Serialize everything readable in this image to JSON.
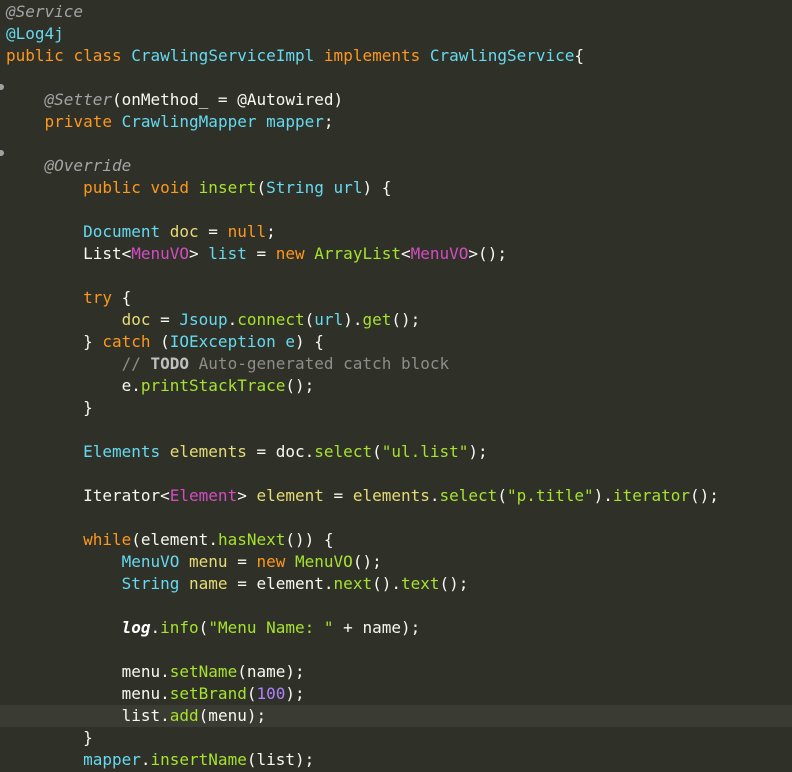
{
  "editor": {
    "lines": [
      {
        "segments": [
          {
            "t": "@Service",
            "c": "tok-annot"
          }
        ]
      },
      {
        "segments": [
          {
            "t": "@Log4j",
            "c": "tok-annot2"
          }
        ]
      },
      {
        "segments": [
          {
            "t": "public",
            "c": "tok-kw2"
          },
          {
            "t": " ",
            "c": "tok-plain"
          },
          {
            "t": "class",
            "c": "tok-kw2"
          },
          {
            "t": " ",
            "c": "tok-plain"
          },
          {
            "t": "CrawlingServiceImpl",
            "c": "tok-type"
          },
          {
            "t": " ",
            "c": "tok-plain"
          },
          {
            "t": "implements",
            "c": "tok-kw2"
          },
          {
            "t": " ",
            "c": "tok-plain"
          },
          {
            "t": "CrawlingService",
            "c": "tok-type"
          },
          {
            "t": "{",
            "c": "tok-plain"
          }
        ]
      },
      {
        "segments": []
      },
      {
        "segments": [
          {
            "t": "    ",
            "c": "tok-plain"
          },
          {
            "t": "@Setter",
            "c": "tok-annot"
          },
          {
            "t": "(onMethod_ = @Autowired)",
            "c": "tok-plain"
          }
        ]
      },
      {
        "segments": [
          {
            "t": "    ",
            "c": "tok-plain"
          },
          {
            "t": "private",
            "c": "tok-kw2"
          },
          {
            "t": " ",
            "c": "tok-plain"
          },
          {
            "t": "CrawlingMapper",
            "c": "tok-type"
          },
          {
            "t": " ",
            "c": "tok-plain"
          },
          {
            "t": "mapper",
            "c": "tok-type"
          },
          {
            "t": ";",
            "c": "tok-plain"
          }
        ]
      },
      {
        "segments": []
      },
      {
        "segments": [
          {
            "t": "    ",
            "c": "tok-plain"
          },
          {
            "t": "@Override",
            "c": "tok-annot"
          }
        ]
      },
      {
        "segments": [
          {
            "t": "        ",
            "c": "tok-plain"
          },
          {
            "t": "public",
            "c": "tok-kw2"
          },
          {
            "t": " ",
            "c": "tok-plain"
          },
          {
            "t": "void",
            "c": "tok-kw2"
          },
          {
            "t": " ",
            "c": "tok-plain"
          },
          {
            "t": "insert",
            "c": "tok-method"
          },
          {
            "t": "(",
            "c": "tok-plain"
          },
          {
            "t": "String",
            "c": "tok-type"
          },
          {
            "t": " ",
            "c": "tok-plain"
          },
          {
            "t": "url",
            "c": "tok-type"
          },
          {
            "t": ") {",
            "c": "tok-plain"
          }
        ]
      },
      {
        "segments": []
      },
      {
        "segments": [
          {
            "t": "        ",
            "c": "tok-plain"
          },
          {
            "t": "Document",
            "c": "tok-type"
          },
          {
            "t": " ",
            "c": "tok-plain"
          },
          {
            "t": "doc",
            "c": "tok-string"
          },
          {
            "t": " = ",
            "c": "tok-plain"
          },
          {
            "t": "null",
            "c": "tok-kw2"
          },
          {
            "t": ";",
            "c": "tok-plain"
          }
        ]
      },
      {
        "segments": [
          {
            "t": "        ",
            "c": "tok-plain"
          },
          {
            "t": "List<",
            "c": "tok-plain"
          },
          {
            "t": "MenuVO",
            "c": "tok-generic"
          },
          {
            "t": "> ",
            "c": "tok-plain"
          },
          {
            "t": "list",
            "c": "tok-type"
          },
          {
            "t": " = ",
            "c": "tok-plain"
          },
          {
            "t": "new",
            "c": "tok-kw2"
          },
          {
            "t": " ",
            "c": "tok-plain"
          },
          {
            "t": "ArrayList",
            "c": "tok-class"
          },
          {
            "t": "<",
            "c": "tok-plain"
          },
          {
            "t": "MenuVO",
            "c": "tok-generic"
          },
          {
            "t": ">();",
            "c": "tok-plain"
          }
        ]
      },
      {
        "segments": []
      },
      {
        "segments": [
          {
            "t": "        ",
            "c": "tok-plain"
          },
          {
            "t": "try",
            "c": "tok-kw2"
          },
          {
            "t": " {",
            "c": "tok-plain"
          }
        ]
      },
      {
        "segments": [
          {
            "t": "            ",
            "c": "tok-plain"
          },
          {
            "t": "doc",
            "c": "tok-string"
          },
          {
            "t": " = ",
            "c": "tok-plain"
          },
          {
            "t": "Jsoup",
            "c": "tok-type"
          },
          {
            "t": ".",
            "c": "tok-plain"
          },
          {
            "t": "connect",
            "c": "tok-method"
          },
          {
            "t": "(",
            "c": "tok-plain"
          },
          {
            "t": "url",
            "c": "tok-type"
          },
          {
            "t": ").",
            "c": "tok-plain"
          },
          {
            "t": "get",
            "c": "tok-method"
          },
          {
            "t": "();",
            "c": "tok-plain"
          }
        ]
      },
      {
        "segments": [
          {
            "t": "        ",
            "c": "tok-plain"
          },
          {
            "t": "} ",
            "c": "tok-plain"
          },
          {
            "t": "catch",
            "c": "tok-kw2"
          },
          {
            "t": " (",
            "c": "tok-plain"
          },
          {
            "t": "IOException",
            "c": "tok-type"
          },
          {
            "t": " ",
            "c": "tok-plain"
          },
          {
            "t": "e",
            "c": "tok-type"
          },
          {
            "t": ") {",
            "c": "tok-plain"
          }
        ]
      },
      {
        "segments": [
          {
            "t": "            ",
            "c": "tok-plain"
          },
          {
            "t": "// ",
            "c": "tok-comment"
          },
          {
            "t": "TODO",
            "c": "tok-todo"
          },
          {
            "t": " Auto-generated catch block",
            "c": "tok-comment"
          }
        ]
      },
      {
        "segments": [
          {
            "t": "            ",
            "c": "tok-plain"
          },
          {
            "t": "e",
            "c": "tok-plain"
          },
          {
            "t": ".",
            "c": "tok-plain"
          },
          {
            "t": "printStackTrace",
            "c": "tok-method"
          },
          {
            "t": "();",
            "c": "tok-plain"
          }
        ]
      },
      {
        "segments": [
          {
            "t": "        ",
            "c": "tok-plain"
          },
          {
            "t": "}",
            "c": "tok-plain"
          }
        ]
      },
      {
        "segments": []
      },
      {
        "segments": [
          {
            "t": "        ",
            "c": "tok-plain"
          },
          {
            "t": "Elements",
            "c": "tok-type"
          },
          {
            "t": " ",
            "c": "tok-plain"
          },
          {
            "t": "elements",
            "c": "tok-string"
          },
          {
            "t": " = ",
            "c": "tok-plain"
          },
          {
            "t": "doc",
            "c": "tok-plain"
          },
          {
            "t": ".",
            "c": "tok-plain"
          },
          {
            "t": "select",
            "c": "tok-method"
          },
          {
            "t": "(",
            "c": "tok-plain"
          },
          {
            "t": "\"ul.list\"",
            "c": "tok-string2"
          },
          {
            "t": ");",
            "c": "tok-plain"
          }
        ]
      },
      {
        "segments": []
      },
      {
        "segments": [
          {
            "t": "        ",
            "c": "tok-plain"
          },
          {
            "t": "Iterator<",
            "c": "tok-plain"
          },
          {
            "t": "Element",
            "c": "tok-generic"
          },
          {
            "t": "> ",
            "c": "tok-plain"
          },
          {
            "t": "element",
            "c": "tok-string"
          },
          {
            "t": " = ",
            "c": "tok-plain"
          },
          {
            "t": "elements",
            "c": "tok-string"
          },
          {
            "t": ".",
            "c": "tok-plain"
          },
          {
            "t": "select",
            "c": "tok-method"
          },
          {
            "t": "(",
            "c": "tok-plain"
          },
          {
            "t": "\"p.title\"",
            "c": "tok-string2"
          },
          {
            "t": ").",
            "c": "tok-plain"
          },
          {
            "t": "iterator",
            "c": "tok-method"
          },
          {
            "t": "();",
            "c": "tok-plain"
          }
        ]
      },
      {
        "segments": []
      },
      {
        "segments": [
          {
            "t": "        ",
            "c": "tok-plain"
          },
          {
            "t": "while",
            "c": "tok-kw2"
          },
          {
            "t": "(",
            "c": "tok-plain"
          },
          {
            "t": "element",
            "c": "tok-plain"
          },
          {
            "t": ".",
            "c": "tok-plain"
          },
          {
            "t": "hasNext",
            "c": "tok-method"
          },
          {
            "t": "()) {",
            "c": "tok-plain"
          }
        ]
      },
      {
        "segments": [
          {
            "t": "            ",
            "c": "tok-plain"
          },
          {
            "t": "MenuVO",
            "c": "tok-type"
          },
          {
            "t": " ",
            "c": "tok-plain"
          },
          {
            "t": "menu",
            "c": "tok-string"
          },
          {
            "t": " = ",
            "c": "tok-plain"
          },
          {
            "t": "new",
            "c": "tok-kw2"
          },
          {
            "t": " ",
            "c": "tok-plain"
          },
          {
            "t": "MenuVO",
            "c": "tok-class"
          },
          {
            "t": "();",
            "c": "tok-plain"
          }
        ]
      },
      {
        "segments": [
          {
            "t": "            ",
            "c": "tok-plain"
          },
          {
            "t": "String",
            "c": "tok-type"
          },
          {
            "t": " ",
            "c": "tok-plain"
          },
          {
            "t": "name",
            "c": "tok-string"
          },
          {
            "t": " = ",
            "c": "tok-plain"
          },
          {
            "t": "element",
            "c": "tok-plain"
          },
          {
            "t": ".",
            "c": "tok-plain"
          },
          {
            "t": "next",
            "c": "tok-method"
          },
          {
            "t": "().",
            "c": "tok-plain"
          },
          {
            "t": "text",
            "c": "tok-method"
          },
          {
            "t": "();",
            "c": "tok-plain"
          }
        ]
      },
      {
        "segments": []
      },
      {
        "segments": [
          {
            "t": "            ",
            "c": "tok-plain"
          },
          {
            "t": "log",
            "c": "tok-italic"
          },
          {
            "t": ".",
            "c": "tok-plain"
          },
          {
            "t": "info",
            "c": "tok-method"
          },
          {
            "t": "(",
            "c": "tok-plain"
          },
          {
            "t": "\"Menu Name: \"",
            "c": "tok-string2"
          },
          {
            "t": " + ",
            "c": "tok-plain"
          },
          {
            "t": "name",
            "c": "tok-plain"
          },
          {
            "t": ");",
            "c": "tok-plain"
          }
        ]
      },
      {
        "segments": []
      },
      {
        "segments": [
          {
            "t": "            ",
            "c": "tok-plain"
          },
          {
            "t": "menu",
            "c": "tok-plain"
          },
          {
            "t": ".",
            "c": "tok-plain"
          },
          {
            "t": "setName",
            "c": "tok-method"
          },
          {
            "t": "(name);",
            "c": "tok-plain"
          }
        ]
      },
      {
        "segments": [
          {
            "t": "            ",
            "c": "tok-plain"
          },
          {
            "t": "menu",
            "c": "tok-plain"
          },
          {
            "t": ".",
            "c": "tok-plain"
          },
          {
            "t": "setBrand",
            "c": "tok-method"
          },
          {
            "t": "(",
            "c": "tok-plain"
          },
          {
            "t": "100",
            "c": "tok-num"
          },
          {
            "t": ");",
            "c": "tok-plain"
          }
        ]
      },
      {
        "segments": [
          {
            "t": "            ",
            "c": "tok-plain"
          },
          {
            "t": "list",
            "c": "tok-plain"
          },
          {
            "t": ".",
            "c": "tok-plain"
          },
          {
            "t": "add",
            "c": "tok-method"
          },
          {
            "t": "(menu);",
            "c": "tok-plain"
          }
        ],
        "current": true
      },
      {
        "segments": [
          {
            "t": "        ",
            "c": "tok-plain"
          },
          {
            "t": "}",
            "c": "tok-plain"
          }
        ]
      },
      {
        "segments": [
          {
            "t": "        ",
            "c": "tok-plain"
          },
          {
            "t": "mapper",
            "c": "tok-type"
          },
          {
            "t": ".",
            "c": "tok-plain"
          },
          {
            "t": "insertName",
            "c": "tok-method"
          },
          {
            "t": "(list);",
            "c": "tok-plain"
          }
        ]
      }
    ],
    "gutter_markers": [
      4,
      7
    ]
  }
}
